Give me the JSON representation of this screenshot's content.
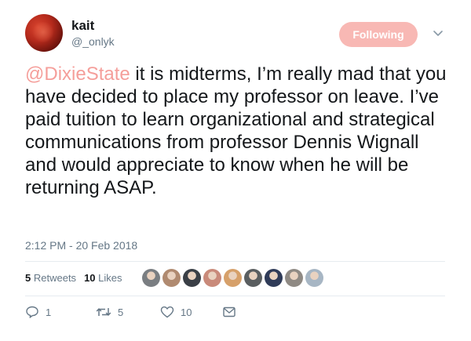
{
  "user": {
    "display_name": "kait",
    "handle": "@_onlyk"
  },
  "follow_button": {
    "label": "Following"
  },
  "tweet": {
    "mention": "@DixieState",
    "text": " it is midterms, I’m really mad that you have decided to place my professor on leave. I’ve paid tuition to learn organizational and strategical communications from professor Dennis Wignall and would appreciate to know when he will be returning ASAP.",
    "timestamp": "2:12 PM - 20 Feb 2018"
  },
  "stats": {
    "retweets_count": "5",
    "retweets_label": "Retweets",
    "likes_count": "10",
    "likes_label": "Likes"
  },
  "likers": [
    {
      "color": "#7a7e82"
    },
    {
      "color": "#b08a70"
    },
    {
      "color": "#3a3f46"
    },
    {
      "color": "#c98a7a"
    },
    {
      "color": "#d6a06a"
    },
    {
      "color": "#5a5e60"
    },
    {
      "color": "#2f3b58"
    },
    {
      "color": "#8f8a84"
    },
    {
      "color": "#a7b6c4"
    }
  ],
  "actions": {
    "reply_count": "1",
    "retweet_count": "5",
    "like_count": "10"
  },
  "colors": {
    "accent": "#f59e9a",
    "follow_bg": "#f8b8b4",
    "muted": "#657786"
  }
}
